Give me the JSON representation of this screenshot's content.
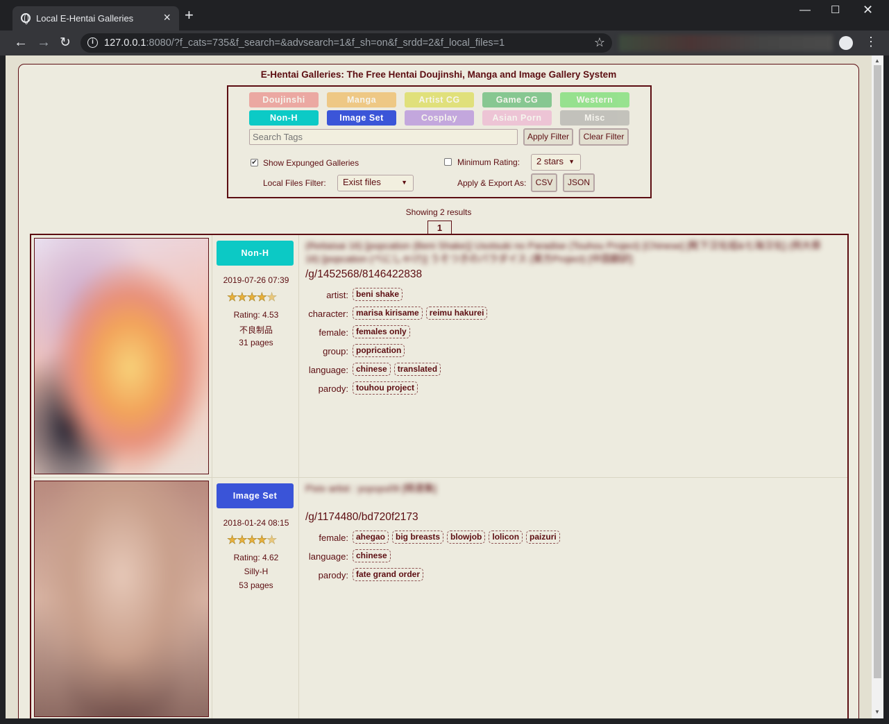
{
  "browser": {
    "tab_title": "Local E-Hentai Galleries",
    "url_host": "127.0.0.1",
    "url_rest": ":8080/?f_cats=735&f_search=&advsearch=1&f_sh=on&f_srdd=2&f_local_files=1"
  },
  "site_title": "E-Hentai Galleries: The Free Hentai Doujinshi, Manga and Image Gallery System",
  "categories": [
    {
      "label": "Doujinshi",
      "color": "#e95959",
      "active": false
    },
    {
      "label": "Manga",
      "color": "#f09e19",
      "active": false
    },
    {
      "label": "Artist CG",
      "color": "#d2d303",
      "active": false
    },
    {
      "label": "Game CG",
      "color": "#0e9d33",
      "active": false
    },
    {
      "label": "Western",
      "color": "#2ed62e",
      "active": false
    },
    {
      "label": "Non-H",
      "color": "#0ccac6",
      "active": true
    },
    {
      "label": "Image Set",
      "color": "#3b55d8",
      "active": true
    },
    {
      "label": "Cosplay",
      "color": "#9255dc",
      "active": false
    },
    {
      "label": "Asian Porn",
      "color": "#ed95ca",
      "active": false
    },
    {
      "label": "Misc",
      "color": "#909090",
      "active": false
    }
  ],
  "search": {
    "placeholder": "Search Tags",
    "apply_label": "Apply Filter",
    "clear_label": "Clear Filter",
    "expunged_label": "Show Expunged Galleries",
    "expunged_checked": true,
    "min_rating_label": "Minimum Rating:",
    "min_rating_checked": false,
    "min_rating_value": "2 stars",
    "local_filter_label": "Local Files Filter:",
    "local_filter_value": "Exist files",
    "export_label": "Apply & Export As:",
    "csv_label": "CSV",
    "json_label": "JSON"
  },
  "results_text": "Showing 2 results",
  "current_page": "1",
  "galleries": [
    {
      "category": "Non-H",
      "category_color": "#0cc9c5",
      "posted": "2019-07-26 07:39",
      "stars": 4.5,
      "rating": "Rating: 4.53",
      "uploader": "不良制品",
      "pages": "31 pages",
      "title": "(Reitaisai 16) [popcation (Beni Shake)] Usotsuki no Paradise (Touhou Project) [Chinese] [靴下汉化组&七海汉化] (例大祭16) [popcation (べにしゃけ)] うそつきのパラダイス (東方Project) [中国翻訳]",
      "link": "/g/1452568/8146422838",
      "tags": [
        {
          "ns": "artist:",
          "values": [
            "beni shake"
          ]
        },
        {
          "ns": "character:",
          "values": [
            "marisa kirisame",
            "reimu hakurei"
          ]
        },
        {
          "ns": "female:",
          "values": [
            "females only"
          ]
        },
        {
          "ns": "group:",
          "values": [
            "poprication"
          ]
        },
        {
          "ns": "language:",
          "values": [
            "chinese",
            "translated"
          ]
        },
        {
          "ns": "parody:",
          "values": [
            "touhou project"
          ]
        }
      ]
    },
    {
      "category": "Image Set",
      "category_color": "#3a54d8",
      "posted": "2018-01-24 08:15",
      "stars": 4.5,
      "rating": "Rating: 4.62",
      "uploader": "Silly-H",
      "pages": "53 pages",
      "title": "Pixiv artist : yuyuyu09 [精選集]",
      "link": "/g/1174480/bd720f2173",
      "tags": [
        {
          "ns": "female:",
          "values": [
            "ahegao",
            "big breasts",
            "blowjob",
            "lolicon",
            "paizuri"
          ]
        },
        {
          "ns": "language:",
          "values": [
            "chinese"
          ]
        },
        {
          "ns": "parody:",
          "values": [
            "fate grand order"
          ]
        }
      ]
    }
  ]
}
